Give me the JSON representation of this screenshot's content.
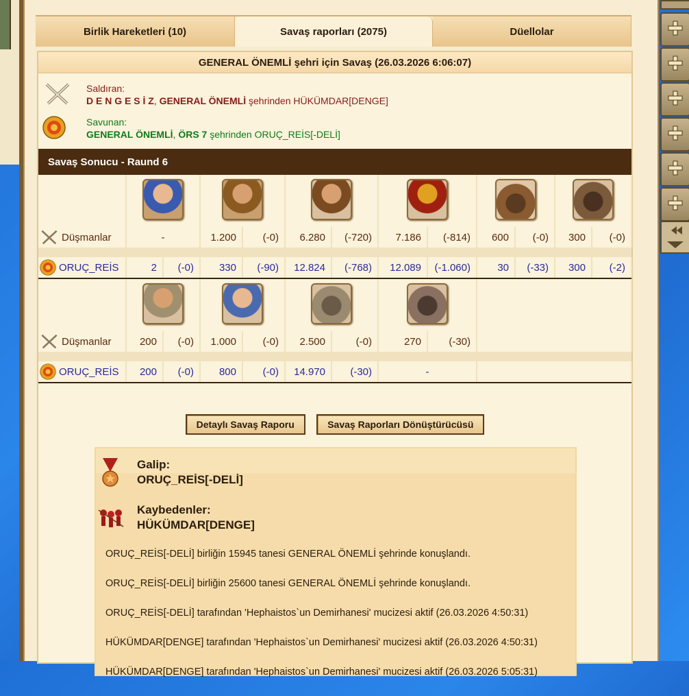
{
  "tabs": [
    {
      "label": "Birlik Hareketleri (10)",
      "active": false
    },
    {
      "label": "Savaş raporları (2075)",
      "active": true
    },
    {
      "label": "Düellolar",
      "active": false
    }
  ],
  "report": {
    "title": "GENERAL ÖNEMLİ şehri için Savaş (26.03.2026 6:06:07)",
    "attacker": {
      "label": "Saldıran:",
      "player": "D E N G E S İ Z",
      "city": "GENERAL ÖNEMLİ",
      "mid": "şehrinden",
      "alliance": "HÜKÜMDAR[DENGE]"
    },
    "defender": {
      "label": "Savunan:",
      "player": "GENERAL ÖNEMLİ",
      "city": "ÖRS 7",
      "mid": "şehrinden",
      "alliance": "ORUÇ_REİS[-DELİ]"
    },
    "result_title": "Savaş Sonucu - Raund 6",
    "enemy_label": "Düşmanlar",
    "own_label": "ORUÇ_REİS",
    "block1": {
      "units": [
        "slinger-unit",
        "trumpeter-unit",
        "swordsman-unit",
        "hoplite-unit",
        "chariot-unit",
        "catapult-unit"
      ],
      "enemy": [
        [
          "-",
          ""
        ],
        [
          "1.200",
          "(-0)"
        ],
        [
          "6.280",
          "(-720)"
        ],
        [
          "7.186",
          "(-814)"
        ],
        [
          "600",
          "(-0)"
        ],
        [
          "300",
          "(-0)"
        ]
      ],
      "own": [
        [
          "2",
          "(-0)"
        ],
        [
          "330",
          "(-90)"
        ],
        [
          "12.824",
          "(-768)"
        ],
        [
          "12.089",
          "(-1.060)"
        ],
        [
          "30",
          "(-33)"
        ],
        [
          "300",
          "(-2)"
        ]
      ]
    },
    "block2": {
      "units": [
        "priest-unit",
        "cook-unit",
        "ballista-unit",
        "siege-tower-unit"
      ],
      "enemy": [
        [
          "200",
          "(-0)"
        ],
        [
          "1.000",
          "(-0)"
        ],
        [
          "2.500",
          "(-0)"
        ],
        [
          "270",
          "(-30)"
        ]
      ],
      "own": [
        [
          "200",
          "(-0)"
        ],
        [
          "800",
          "(-0)"
        ],
        [
          "14.970",
          "(-30)"
        ],
        [
          "-",
          ""
        ]
      ]
    },
    "buttons": {
      "detail": "Detaylı Savaş Raporu",
      "converter": "Savaş Raporları Dönüştürücüsü"
    },
    "summary": {
      "winner_label": "Galip:",
      "winner_name": "ORUÇ_REİS[-DELİ]",
      "loser_label": "Kaybedenler:",
      "loser_name": "HÜKÜMDAR[DENGE]",
      "log": [
        "ORUÇ_REİS[-DELİ] birliğin 15945 tanesi GENERAL ÖNEMLİ şehrinde konuşlandı.",
        "ORUÇ_REİS[-DELİ] birliğin 25600 tanesi GENERAL ÖNEMLİ şehrinde konuşlandı.",
        "ORUÇ_REİS[-DELİ] tarafından 'Hephaistos`un Demirhanesi' mucizesi aktif (26.03.2026 4:50:31)",
        "HÜKÜMDAR[DENGE] tarafından 'Hephaistos`un Demirhanesi' mucizesi aktif (26.03.2026 4:50:31)",
        "HÜKÜMDAR[DENGE] tarafından 'Hephaistos`un Demirhanesi' mucizesi aktif (26.03.2026 5:05:31)"
      ]
    }
  },
  "colors": {
    "attacker": "#8b1a1a",
    "defender": "#0f7a1a",
    "own_row": "#2a2a9c",
    "header_bg": "#4b2c10"
  }
}
